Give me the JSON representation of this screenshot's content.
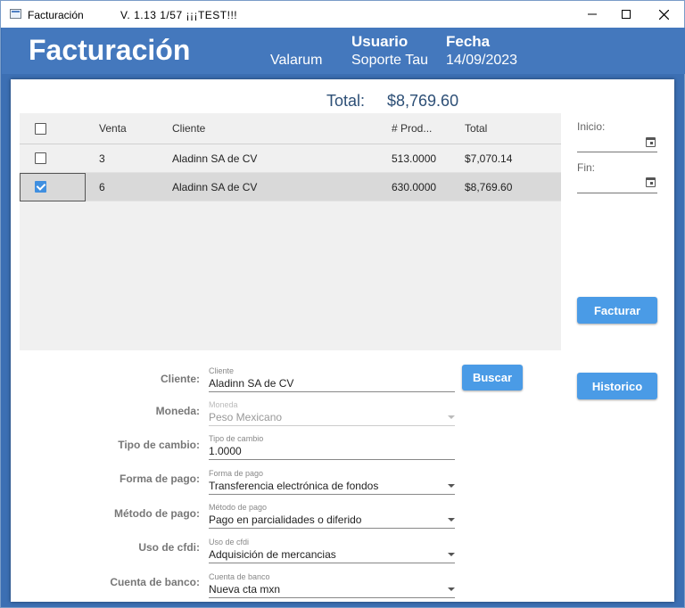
{
  "window": {
    "title": "Facturación",
    "version": "V. 1.13   1/57  ¡¡¡TEST!!!"
  },
  "header": {
    "brand": "Facturación",
    "company": "Valarum",
    "user_label": "Usuario",
    "user_value": "Soporte Tau",
    "date_label": "Fecha",
    "date_value": "14/09/2023"
  },
  "summary": {
    "total_label": "Total:",
    "total_value": "$8,769.60"
  },
  "grid": {
    "columns": [
      "Venta",
      "Cliente",
      "# Prod...",
      "Total"
    ],
    "rows": [
      {
        "selected": false,
        "venta": "3",
        "cliente": "Aladinn SA de CV",
        "productos": "513.0000",
        "total": "$7,070.14"
      },
      {
        "selected": true,
        "venta": "6",
        "cliente": "Aladinn SA de CV",
        "productos": "630.0000",
        "total": "$8,769.60"
      }
    ]
  },
  "filters": {
    "inicio_label": "Inicio:",
    "fin_label": "Fin:"
  },
  "buttons": {
    "facturar": "Facturar",
    "historico": "Historico",
    "buscar": "Buscar"
  },
  "form": {
    "cliente": {
      "label": "Cliente:",
      "caption": "Cliente",
      "value": "Aladinn SA de CV"
    },
    "moneda": {
      "label": "Moneda:",
      "caption": "Moneda",
      "value": "Peso Mexicano"
    },
    "tipo_cambio": {
      "label": "Tipo de cambio:",
      "caption": "Tipo de cambio",
      "value": "1.0000"
    },
    "forma_pago": {
      "label": "Forma de pago:",
      "caption": "Forma de pago",
      "value": "Transferencia electrónica de fondos"
    },
    "metodo_pago": {
      "label": "Método de pago:",
      "caption": "Método de pago",
      "value": "Pago en parcialidades o diferido"
    },
    "uso_cfdi": {
      "label": "Uso de cfdi:",
      "caption": "Uso de cfdi",
      "value": "Adquisición de mercancias"
    },
    "cuenta_banco": {
      "label": "Cuenta de banco:",
      "caption": "Cuenta de banco",
      "value": "Nueva cta mxn"
    }
  },
  "colors": {
    "header_blue": "#4478bd",
    "button_blue": "#4a9be6",
    "total_text": "#2d4f76"
  }
}
